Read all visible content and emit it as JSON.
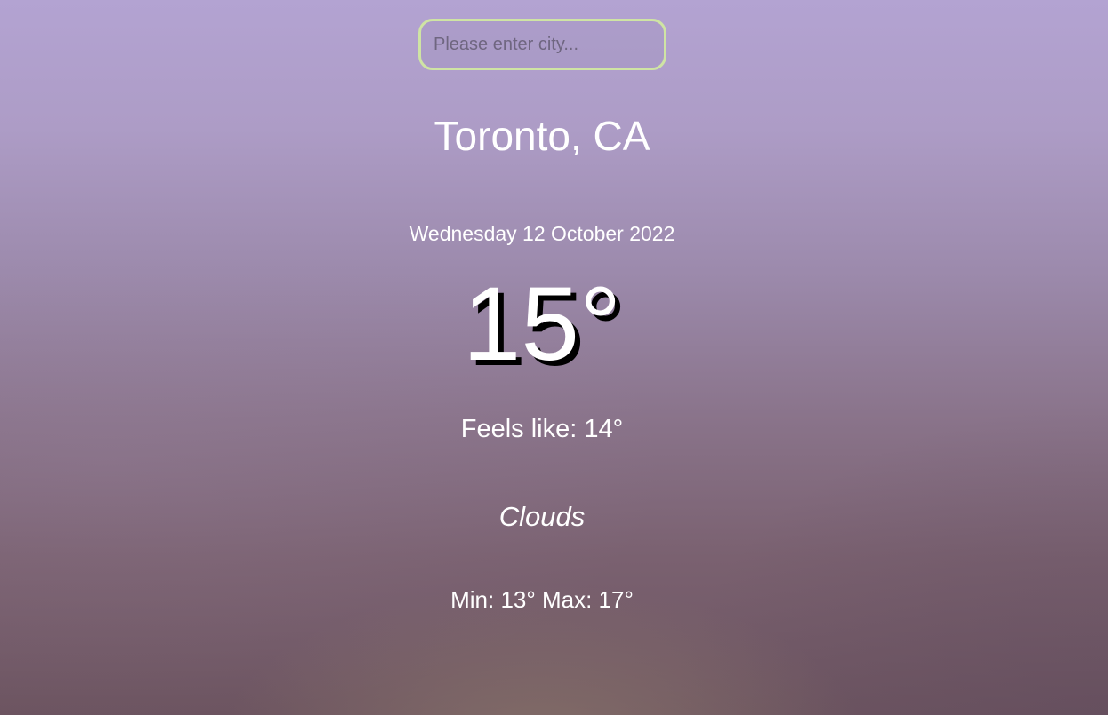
{
  "search": {
    "value": "",
    "placeholder": "Please enter city..."
  },
  "location": {
    "city_label": "Toronto, CA"
  },
  "weather": {
    "date": "Wednesday 12 October 2022",
    "temperature": "15°",
    "feels_like": "Feels like: 14°",
    "condition": "Clouds",
    "min_max": "Min: 13° Max: 17°"
  },
  "colors": {
    "search_border": "#cfe4a4",
    "text": "#ffffff",
    "temp_shadow": "#000000"
  }
}
